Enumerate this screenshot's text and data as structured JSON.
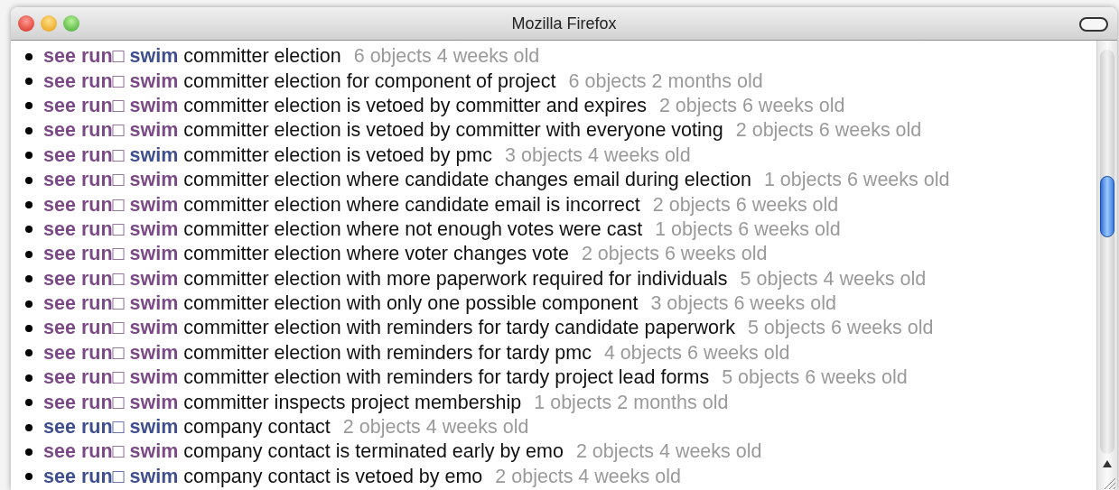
{
  "window": {
    "title": "Mozilla Firefox"
  },
  "rows": [
    {
      "links": [
        {
          "label": "see",
          "visited": true
        },
        {
          "label": "run□",
          "visited": true
        },
        {
          "label": "swim",
          "visited": false
        }
      ],
      "title": "committer election",
      "meta": "6 objects 4 weeks old"
    },
    {
      "links": [
        {
          "label": "see",
          "visited": true
        },
        {
          "label": "run□",
          "visited": true
        },
        {
          "label": "swim",
          "visited": true
        }
      ],
      "title": "committer election for component of project",
      "meta": "6 objects 2 months old"
    },
    {
      "links": [
        {
          "label": "see",
          "visited": true
        },
        {
          "label": "run□",
          "visited": true
        },
        {
          "label": "swim",
          "visited": true
        }
      ],
      "title": "committer election is vetoed by committer and expires",
      "meta": "2 objects 6 weeks old"
    },
    {
      "links": [
        {
          "label": "see",
          "visited": true
        },
        {
          "label": "run□",
          "visited": true
        },
        {
          "label": "swim",
          "visited": true
        }
      ],
      "title": "committer election is vetoed by committer with everyone voting",
      "meta": "2 objects 6 weeks old"
    },
    {
      "links": [
        {
          "label": "see",
          "visited": true
        },
        {
          "label": "run□",
          "visited": true
        },
        {
          "label": "swim",
          "visited": false
        }
      ],
      "title": "committer election is vetoed by pmc",
      "meta": "3 objects 4 weeks old"
    },
    {
      "links": [
        {
          "label": "see",
          "visited": true
        },
        {
          "label": "run□",
          "visited": true
        },
        {
          "label": "swim",
          "visited": true
        }
      ],
      "title": "committer election where candidate changes email during election",
      "meta": "1 objects 6 weeks old"
    },
    {
      "links": [
        {
          "label": "see",
          "visited": true
        },
        {
          "label": "run□",
          "visited": true
        },
        {
          "label": "swim",
          "visited": true
        }
      ],
      "title": "committer election where candidate email is incorrect",
      "meta": "2 objects 6 weeks old"
    },
    {
      "links": [
        {
          "label": "see",
          "visited": true
        },
        {
          "label": "run□",
          "visited": true
        },
        {
          "label": "swim",
          "visited": true
        }
      ],
      "title": "committer election where not enough votes were cast",
      "meta": "1 objects 6 weeks old"
    },
    {
      "links": [
        {
          "label": "see",
          "visited": true
        },
        {
          "label": "run□",
          "visited": true
        },
        {
          "label": "swim",
          "visited": true
        }
      ],
      "title": "committer election where voter changes vote",
      "meta": "2 objects 6 weeks old"
    },
    {
      "links": [
        {
          "label": "see",
          "visited": true
        },
        {
          "label": "run□",
          "visited": true
        },
        {
          "label": "swim",
          "visited": true
        }
      ],
      "title": "committer election with more paperwork required for individuals",
      "meta": "5 objects 4 weeks old"
    },
    {
      "links": [
        {
          "label": "see",
          "visited": true
        },
        {
          "label": "run□",
          "visited": true
        },
        {
          "label": "swim",
          "visited": true
        }
      ],
      "title": "committer election with only one possible component",
      "meta": "3 objects 6 weeks old"
    },
    {
      "links": [
        {
          "label": "see",
          "visited": true
        },
        {
          "label": "run□",
          "visited": true
        },
        {
          "label": "swim",
          "visited": true
        }
      ],
      "title": "committer election with reminders for tardy candidate paperwork",
      "meta": "5 objects 6 weeks old"
    },
    {
      "links": [
        {
          "label": "see",
          "visited": true
        },
        {
          "label": "run□",
          "visited": true
        },
        {
          "label": "swim",
          "visited": true
        }
      ],
      "title": "committer election with reminders for tardy pmc",
      "meta": "4 objects 6 weeks old"
    },
    {
      "links": [
        {
          "label": "see",
          "visited": true
        },
        {
          "label": "run□",
          "visited": true
        },
        {
          "label": "swim",
          "visited": true
        }
      ],
      "title": "committer election with reminders for tardy project lead forms",
      "meta": "5 objects 6 weeks old"
    },
    {
      "links": [
        {
          "label": "see",
          "visited": true
        },
        {
          "label": "run□",
          "visited": true
        },
        {
          "label": "swim",
          "visited": true
        }
      ],
      "title": "committer inspects project membership",
      "meta": "1 objects 2 months old"
    },
    {
      "links": [
        {
          "label": "see",
          "visited": false
        },
        {
          "label": "run□",
          "visited": false
        },
        {
          "label": "swim",
          "visited": false
        }
      ],
      "title": "company contact",
      "meta": "2 objects 4 weeks old"
    },
    {
      "links": [
        {
          "label": "see",
          "visited": true
        },
        {
          "label": "run□",
          "visited": true
        },
        {
          "label": "swim",
          "visited": true
        }
      ],
      "title": "company contact is terminated early by emo",
      "meta": "2 objects 4 weeks old"
    },
    {
      "links": [
        {
          "label": "see",
          "visited": false
        },
        {
          "label": "run□",
          "visited": false
        },
        {
          "label": "swim",
          "visited": false
        }
      ],
      "title": "company contact is vetoed by emo",
      "meta": "2 objects 4 weeks old"
    }
  ]
}
